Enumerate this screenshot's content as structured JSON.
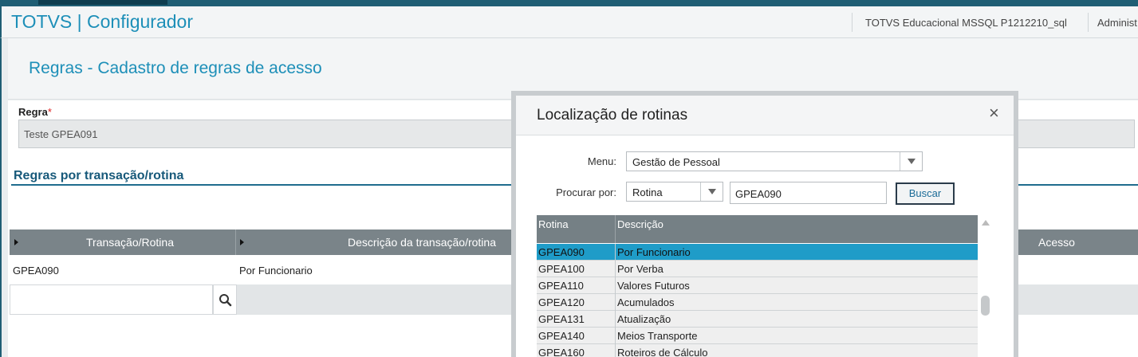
{
  "header": {
    "app_title": "TOTVS | Configurador",
    "environment": "TOTVS Educacional MSSQL P1212210_sql",
    "user": "Administ"
  },
  "page": {
    "title": "Regras - Cadastro de regras de acesso",
    "regra_label": "Regra",
    "regra_required": "*",
    "regra_value": "Teste GPEA091",
    "section_title": "Regras por transação/rotina"
  },
  "grid": {
    "columns": [
      "Transação/Rotina",
      "Descrição da transação/rotina",
      "Acesso"
    ],
    "rows": [
      {
        "rotina": "GPEA090",
        "descricao": "Por Funcionario"
      }
    ]
  },
  "dialog": {
    "title": "Localização de rotinas",
    "close_label": "×",
    "menu_label": "Menu:",
    "menu_value": "Gestão de Pessoal",
    "procurar_label": "Procurar por:",
    "procurar_value": "Rotina",
    "search_value": "GPEA090",
    "buscar_label": "Buscar",
    "table": {
      "headers": [
        "Rotina",
        "Descrição"
      ],
      "rows": [
        {
          "rotina": "GPEA090",
          "descricao": "Por Funcionario",
          "selected": true
        },
        {
          "rotina": "GPEA100",
          "descricao": "Por Verba"
        },
        {
          "rotina": "GPEA110",
          "descricao": "Valores Futuros"
        },
        {
          "rotina": "GPEA120",
          "descricao": "Acumulados"
        },
        {
          "rotina": "GPEA131",
          "descricao": "Atualização"
        },
        {
          "rotina": "GPEA140",
          "descricao": "Meios Transporte"
        },
        {
          "rotina": "GPEA160",
          "descricao": "Roteiros de Cálculo"
        }
      ]
    }
  },
  "icons": {
    "search": "search-icon",
    "close": "close-icon",
    "dropdown": "chevron-down-icon",
    "sort": "sort-arrow-icon"
  },
  "colors": {
    "brand": "#1d8fb8",
    "selected_row": "#1f9cc8",
    "grid_header": "#7a8489"
  }
}
